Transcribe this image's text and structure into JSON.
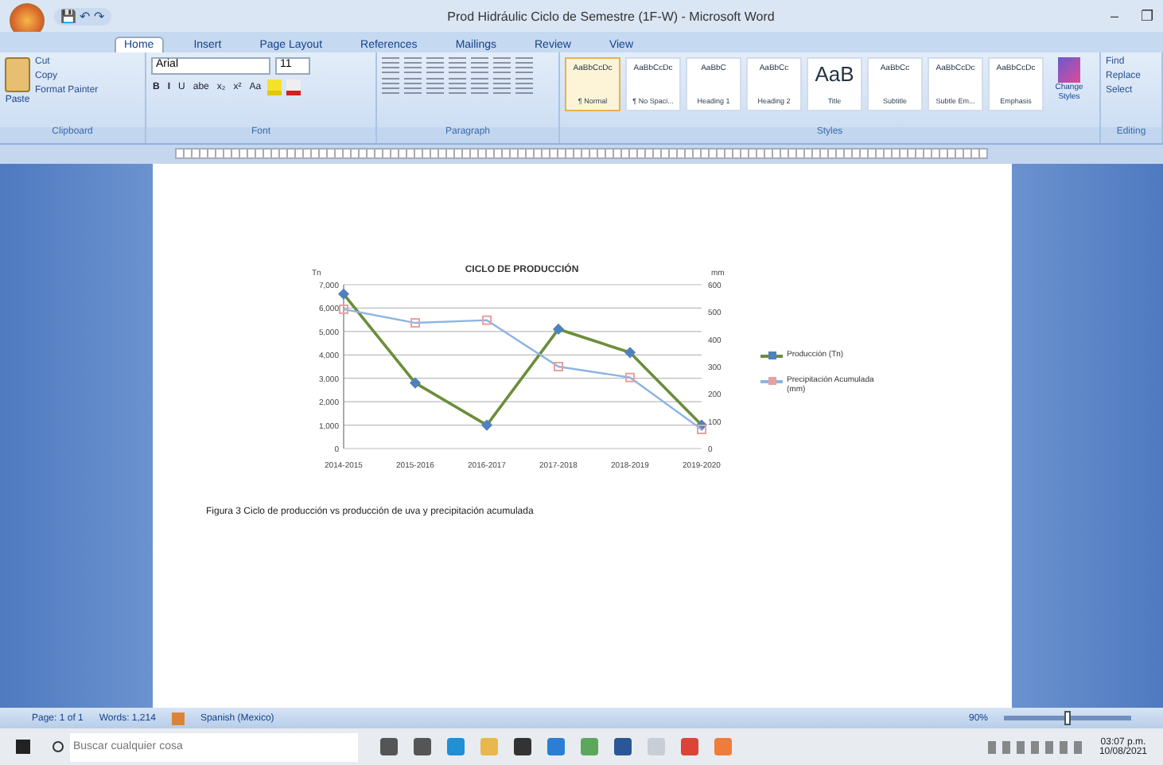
{
  "window": {
    "title": "Prod Hidráulic Ciclo de Semestre (1F-W) - Microsoft Word"
  },
  "quick_access": [
    "💾",
    "↶",
    "↷"
  ],
  "window_controls": [
    "–",
    "❐"
  ],
  "tabs": [
    {
      "label": "Home",
      "selected": true
    },
    {
      "label": "Insert",
      "selected": false
    },
    {
      "label": "Page Layout",
      "selected": false
    },
    {
      "label": "References",
      "selected": false
    },
    {
      "label": "Mailings",
      "selected": false
    },
    {
      "label": "Review",
      "selected": false
    },
    {
      "label": "View",
      "selected": false
    }
  ],
  "ribbon": {
    "clipboard": {
      "paste": "Paste",
      "items": [
        "Cut",
        "Copy",
        "Format Painter"
      ],
      "label": "Clipboard"
    },
    "font": {
      "name": "Arial",
      "size": "11",
      "label": "Font",
      "buttons": [
        "B",
        "I",
        "U",
        "abe",
        "x₂",
        "x²",
        "Aa"
      ]
    },
    "paragraph": {
      "label": "Paragraph"
    },
    "styles": {
      "label": "Styles",
      "items": [
        {
          "sample": "AaBbCcDc",
          "name": "¶ Normal",
          "selected": true
        },
        {
          "sample": "AaBbCcDc",
          "name": "¶ No Spaci...",
          "selected": false
        },
        {
          "sample": "AaBbC",
          "name": "Heading 1",
          "selected": false
        },
        {
          "sample": "AaBbCc",
          "name": "Heading 2",
          "selected": false
        },
        {
          "sample": "AaB",
          "name": "Title",
          "selected": false
        },
        {
          "sample": "AaBbCc",
          "name": "Subtitle",
          "selected": false
        },
        {
          "sample": "AaBbCcDc",
          "name": "Subtle Em...",
          "selected": false
        },
        {
          "sample": "AaBbCcDc",
          "name": "Emphasis",
          "selected": false
        }
      ],
      "change": "Change Styles"
    },
    "editing": {
      "items": [
        "Find",
        "Replace",
        "Select"
      ],
      "label": "Editing"
    }
  },
  "document": {
    "chart_data": {
      "type": "line",
      "title": "CICLO DE PRODUCCIÓN",
      "ylabel": "Tn",
      "y2label": "mm",
      "categories": [
        "2014-2015",
        "2015-2016",
        "2016-2017",
        "2017-2018",
        "2018-2019",
        "2019-2020"
      ],
      "series": [
        {
          "name": "Producción (Tn)",
          "color": "#6b8e3a",
          "marker": "diamond",
          "values": [
            6600,
            2800,
            1000,
            5100,
            4100,
            1000
          ]
        },
        {
          "name": "Precipitación Acumulada (mm)",
          "color": "#8db4e2",
          "axis": "y2",
          "marker": "square",
          "values": [
            510,
            460,
            470,
            300,
            260,
            70
          ]
        }
      ],
      "ylim": [
        0,
        7000
      ],
      "yticks": [
        {
          "value": 0,
          "label": "0"
        },
        {
          "value": 1000,
          "label": "1,000"
        },
        {
          "value": 2000,
          "label": "2,000"
        },
        {
          "value": 3000,
          "label": "3,000"
        },
        {
          "value": 4000,
          "label": "4,000"
        },
        {
          "value": 5000,
          "label": "5,000"
        },
        {
          "value": 6000,
          "label": "6,000"
        },
        {
          "value": 7000,
          "label": "7,000"
        }
      ],
      "grid": true,
      "legend": "right",
      "y2lim": [
        0,
        600
      ],
      "y2ticks": [
        0,
        100,
        200,
        300,
        400,
        500,
        600
      ]
    },
    "caption": "Figura 3 Ciclo de producción vs producción de uva y precipitación acumulada"
  },
  "status_bar": {
    "page": "Page: 1 of 1",
    "words": "Words: 1,214",
    "language": "Spanish (Mexico)",
    "zoom": "90%",
    "zoom_slider": {
      "level": 0.5
    }
  },
  "taskbar": {
    "search_placeholder": "Buscar cualquier cosa",
    "time": "03:07 p.m.",
    "date": "10/08/2021"
  }
}
